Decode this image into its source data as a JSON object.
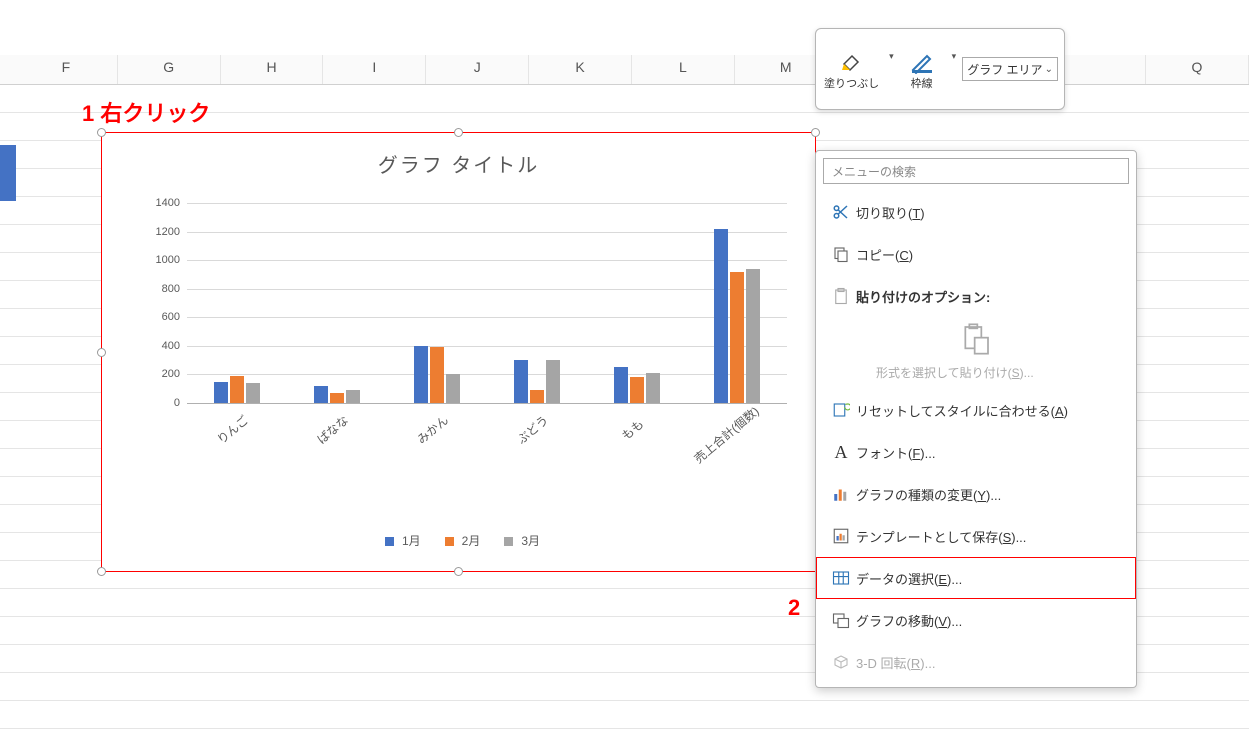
{
  "columns": [
    "F",
    "G",
    "H",
    "I",
    "J",
    "K",
    "L",
    "M",
    "",
    "",
    "",
    "Q"
  ],
  "annotations": {
    "a1": "1 右クリック",
    "a2": "2"
  },
  "toolbar": {
    "fill_label": "塗りつぶし",
    "border_label": "枠線",
    "area_select": "グラフ エリア"
  },
  "chart_data": {
    "type": "bar",
    "title": "グラフ タイトル",
    "categories": [
      "りんご",
      "ばなな",
      "みかん",
      "ぶどう",
      "もも",
      "売上合計(個数)"
    ],
    "series": [
      {
        "name": "1月",
        "values": [
          150,
          120,
          400,
          300,
          250,
          1220
        ],
        "color": "#4472C4"
      },
      {
        "name": "2月",
        "values": [
          190,
          70,
          390,
          90,
          180,
          920
        ],
        "color": "#ED7D31"
      },
      {
        "name": "3月",
        "values": [
          140,
          90,
          200,
          300,
          210,
          940
        ],
        "color": "#A5A5A5"
      }
    ],
    "ylim": [
      0,
      1400
    ],
    "yticks": [
      0,
      200,
      400,
      600,
      800,
      1000,
      1200,
      1400
    ],
    "xlabel": "",
    "ylabel": ""
  },
  "context_menu": {
    "search_placeholder": "メニューの検索",
    "cut": "切り取り(",
    "cut_k": "T",
    "cut2": ")",
    "copy": "コピー(",
    "copy_k": "C",
    "copy2": ")",
    "paste_header": "貼り付けのオプション:",
    "paste_special": "形式を選択して貼り付け(",
    "paste_special_k": "S",
    "paste_special2": ")...",
    "reset": "リセットしてスタイルに合わせる(",
    "reset_k": "A",
    "reset2": ")",
    "font": "フォント(",
    "font_k": "F",
    "font2": ")...",
    "change_type": "グラフの種類の変更(",
    "change_type_k": "Y",
    "change_type2": ")...",
    "save_template": "テンプレートとして保存(",
    "save_template_k": "S",
    "save_template2": ")...",
    "select_data": "データの選択(",
    "select_data_k": "E",
    "select_data2": ")...",
    "move_chart": "グラフの移動(",
    "move_chart_k": "V",
    "move_chart2": ")...",
    "rotate3d": "3-D 回転(",
    "rotate3d_k": "R",
    "rotate3d2": ")..."
  }
}
